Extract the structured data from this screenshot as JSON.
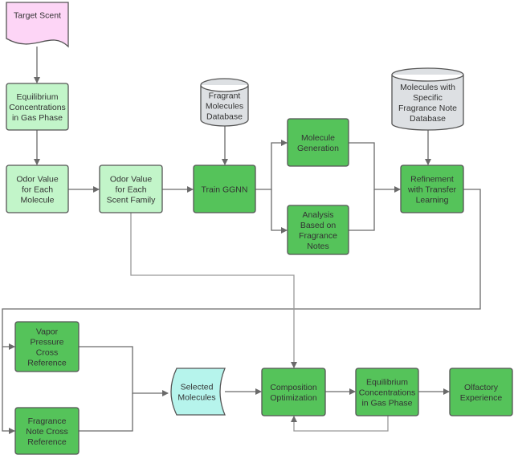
{
  "colors": {
    "light_green": "#c2f5c9",
    "dark_green": "#55c35a",
    "pink": "#fdd5f6",
    "cyan": "#b6f4ec",
    "database": "#dde0e3"
  },
  "nodes": {
    "target_scent": [
      "Target Scent"
    ],
    "eq_conc_top": [
      "Equilibrium",
      "Concentrations",
      "in Gas Phase"
    ],
    "odor_molecule": [
      "Odor Value",
      "for Each",
      "Molecule"
    ],
    "odor_family": [
      "Odor Value",
      "for Each",
      "Scent Family"
    ],
    "train_ggnn": [
      "Train GGNN"
    ],
    "fragrant_db": [
      "Fragrant",
      "Molecules",
      "Database"
    ],
    "mol_gen": [
      "Molecule",
      "Generation"
    ],
    "analysis": [
      "Analysis",
      "Based on",
      "Fragrance",
      "Notes"
    ],
    "note_db": [
      "Molecules with",
      "Specific",
      "Fragrance Note",
      "Database"
    ],
    "refinement": [
      "Refinement",
      "with Transfer",
      "Learning"
    ],
    "vapor": [
      "Vapor",
      "Pressure",
      "Cross",
      "Reference"
    ],
    "fragrance_ref": [
      "Fragrance",
      "Note Cross",
      "Reference"
    ],
    "selected": [
      "Selected",
      "Molecules"
    ],
    "composition": [
      "Composition",
      "Optimization"
    ],
    "eq_conc_bottom": [
      "Equilibrium",
      "Concentrations",
      "in Gas Phase"
    ],
    "olfactory": [
      "Olfactory",
      "Experience"
    ]
  }
}
